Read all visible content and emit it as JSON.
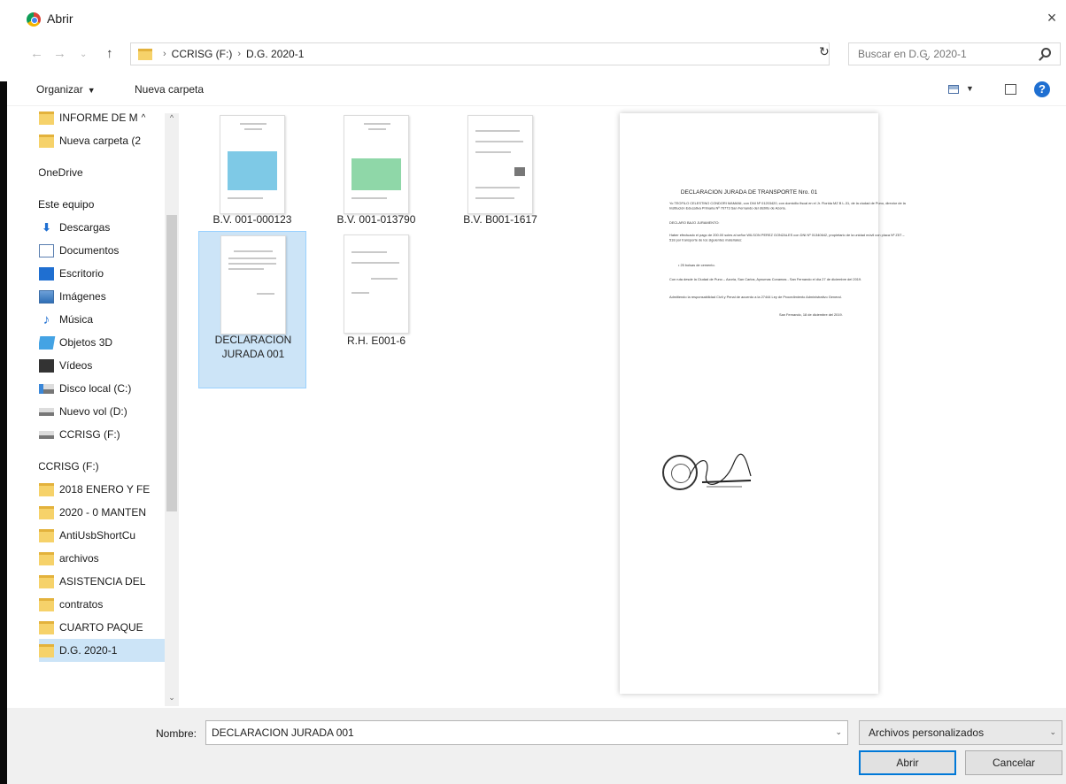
{
  "window": {
    "title": "Abrir",
    "close": "×"
  },
  "nav": {
    "back": "←",
    "forward": "→",
    "up": "↑",
    "refresh": "↻",
    "history": "⌄"
  },
  "breadcrumb": [
    "CCRISG (F:)",
    "D.G. 2020-1"
  ],
  "search": {
    "placeholder": "Buscar en D.G. 2020-1"
  },
  "toolbar": {
    "organize": "Organizar",
    "new_folder": "Nueva carpeta",
    "help": "?"
  },
  "sidebar": {
    "items": [
      {
        "label": "INFORME DE M",
        "icon": "folder-icon"
      },
      {
        "label": "Nueva carpeta (2",
        "icon": "folder-icon"
      },
      {
        "label": "OneDrive",
        "icon": "cloud-icon"
      },
      {
        "label": "Este equipo",
        "icon": "computer-icon"
      },
      {
        "label": "Descargas",
        "icon": "download-icon"
      },
      {
        "label": "Documentos",
        "icon": "document-icon"
      },
      {
        "label": "Escritorio",
        "icon": "desktop-icon"
      },
      {
        "label": "Imágenes",
        "icon": "pictures-icon"
      },
      {
        "label": "Música",
        "icon": "music-icon"
      },
      {
        "label": "Objetos 3D",
        "icon": "cube-icon"
      },
      {
        "label": "Vídeos",
        "icon": "video-icon"
      },
      {
        "label": "Disco local (C:)",
        "icon": "drive-icon"
      },
      {
        "label": "Nuevo vol (D:)",
        "icon": "drive-icon"
      },
      {
        "label": "CCRISG (F:)",
        "icon": "drive-icon"
      },
      {
        "label": "CCRISG (F:)",
        "icon": "drive-icon"
      },
      {
        "label": "2018 ENERO Y FE",
        "icon": "folder-icon"
      },
      {
        "label": "2020 - 0 MANTEN",
        "icon": "folder-icon"
      },
      {
        "label": "AntiUsbShortCu",
        "icon": "folder-icon"
      },
      {
        "label": "archivos",
        "icon": "folder-icon"
      },
      {
        "label": "ASISTENCIA DEL",
        "icon": "folder-icon"
      },
      {
        "label": "contratos",
        "icon": "folder-icon"
      },
      {
        "label": "CUARTO PAQUE",
        "icon": "folder-icon"
      },
      {
        "label": "D.G. 2020-1",
        "icon": "folder-icon",
        "selected": true
      }
    ]
  },
  "files": [
    {
      "name": "B.V. 001-000123"
    },
    {
      "name": "B.V. 001-013790"
    },
    {
      "name": "B.V. B001-1617"
    },
    {
      "name": "DECLARACION JURADA 001",
      "selected": true
    },
    {
      "name": "R.H. E001-6"
    }
  ],
  "preview": {
    "title": "DECLARACION JURADA DE TRANSPORTE Nro. 01",
    "p1": "Yo TEOFILO CELESTINO CONDORI MAMANI, con DNI Nº 01203420, con domicilio fiscal en el Jr. Florida MZ B L-31, de la ciudad de Puno, director de la Institución Educativa Primaria Nº 70773 San Fernando del distrito de Azoria.",
    "p2": "DECLARO BAJO JURAMENTO:",
    "p3": "Haber efectuado el pago de 200.00 soles al señor WILSON PEREZ GONZALES con DNI Nº 01340642, propietario de la unidad móvil con placa Nº Z5T – 518 por transporte de los siguientes materiales:",
    "p4": "• 25 bolsas de cemento.",
    "p5": "Con ruta desde la Ciudad de Puno – Azoria, San Carlos, Aynumas Conamas - San Fernando el día 27 de diciembre del 2019.",
    "p6": "Admitiendo la responsabilidad Civil y Penal de acuerdo a la 27444 Ley de Procedimiento Administrativo General.",
    "p7": "San Fernando, 18 de diciembre del 2019."
  },
  "bottom": {
    "name_label": "Nombre:",
    "name_value": "DECLARACION JURADA 001",
    "type_value": "Archivos personalizados",
    "open": "Abrir",
    "cancel": "Cancelar"
  }
}
